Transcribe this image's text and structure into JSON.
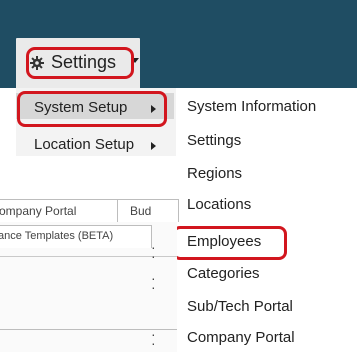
{
  "settings_menu": {
    "label": "Settings"
  },
  "submenu": {
    "items": [
      {
        "label": "System Setup"
      },
      {
        "label": "Location Setup"
      }
    ]
  },
  "system_setup_menu": {
    "items": [
      {
        "label": "System Information"
      },
      {
        "label": "Settings"
      },
      {
        "label": "Regions"
      },
      {
        "label": "Locations"
      },
      {
        "label": "Employees"
      },
      {
        "label": "Categories"
      },
      {
        "label": "Sub/Tech Portal"
      },
      {
        "label": "Company Portal"
      }
    ]
  },
  "tabs": [
    {
      "label": "ompany Portal"
    },
    {
      "label": "Bud"
    },
    {
      "label": "ance Templates (BETA)"
    }
  ],
  "colors": {
    "header_bg": "#1f4d63",
    "highlight": "#d2161e",
    "submenu_bg": "#f3f3f3",
    "selected_bg": "#d7d7d7"
  }
}
